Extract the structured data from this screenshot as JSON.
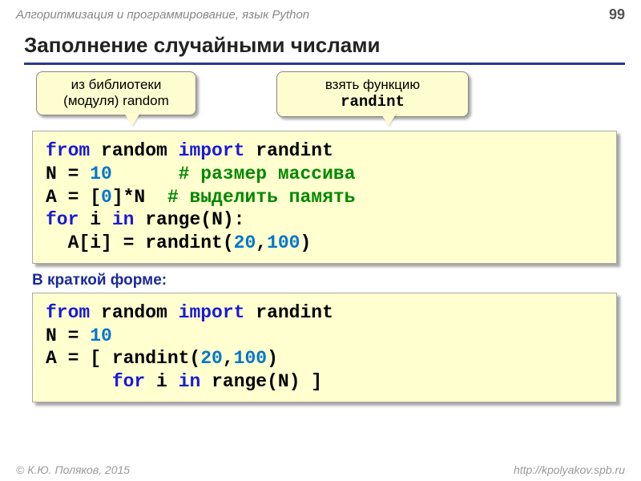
{
  "header": {
    "course": "Алгоритмизация и программирование, язык Python",
    "page": "99"
  },
  "title": "Заполнение случайными числами",
  "callouts": {
    "left": "из библиотеки (модуля) random",
    "right_line1": "взять функцию",
    "right_line2": "randint"
  },
  "code1": {
    "l1a": "from",
    "l1b": " random ",
    "l1c": "import",
    "l1d": " randint",
    "l2a": "N = ",
    "l2b": "10",
    "l2c": "      ",
    "l2d": "# размер массива",
    "l3a": "A = [",
    "l3b": "0",
    "l3c": "]*N  ",
    "l3d": "# выделить память",
    "l4a": "for",
    "l4b": " i ",
    "l4c": "in",
    "l4d": " range(N):",
    "l5a": "  A[i] = randint(",
    "l5b": "20",
    "l5c": ",",
    "l5d": "100",
    "l5e": ")"
  },
  "subhead": "В краткой форме:",
  "code2": {
    "l1a": "from",
    "l1b": " random ",
    "l1c": "import",
    "l1d": " randint",
    "l2a": "N = ",
    "l2b": "10",
    "l3a": "A = [ randint(",
    "l3b": "20",
    "l3c": ",",
    "l3d": "100",
    "l3e": ")",
    "l4a": "      ",
    "l4b": "for",
    "l4c": " i ",
    "l4d": "in",
    "l4e": " range(N) ]"
  },
  "footer": {
    "author": "© К.Ю. Поляков, 2015",
    "url": "http://kpolyakov.spb.ru"
  }
}
